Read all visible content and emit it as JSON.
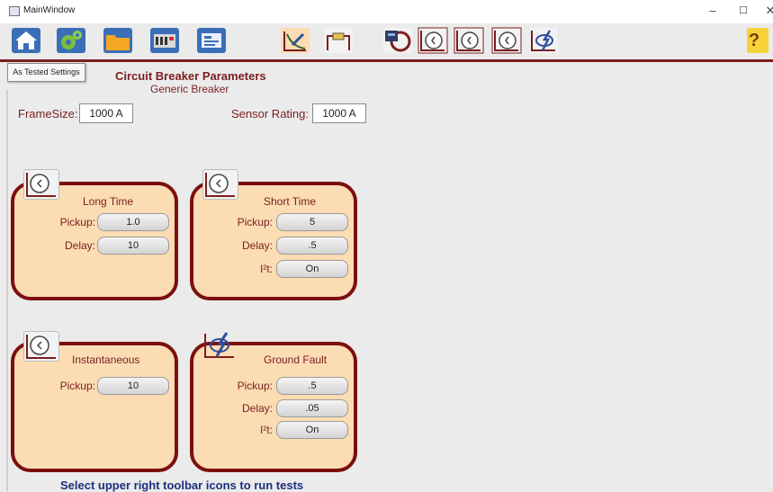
{
  "window": {
    "title": "MainWindow",
    "minimize": "–",
    "maximize": "☐",
    "close": "✕"
  },
  "toolbar": {
    "items": [
      "home-icon",
      "settings-gear-icon",
      "folder-icon",
      "test-set-icon",
      "breaker-settings-icon",
      "curve-edit-icon",
      "cable-connect-icon",
      "cb-test-icon",
      "long-time-test-icon",
      "short-time-test-icon",
      "instantaneous-test-icon",
      "ground-fault-test-icon",
      "help-icon"
    ],
    "help_label": "?"
  },
  "tooltip": "As Tested Settings",
  "header": {
    "title": "Circuit Breaker Parameters",
    "subtitle": "Generic Breaker"
  },
  "frame": {
    "label": "FrameSize:",
    "value": "1000 A"
  },
  "sensor": {
    "label": "Sensor Rating:",
    "value": "1000 A"
  },
  "long_time": {
    "title": "Long Time",
    "pickup_label": "Pickup:",
    "pickup": "1.0",
    "delay_label": "Delay:",
    "delay": "10"
  },
  "short_time": {
    "title": "Short Time",
    "pickup_label": "Pickup:",
    "pickup": "5",
    "delay_label": "Delay:",
    "delay": ".5",
    "i2t_label": "I²t:",
    "i2t": "On"
  },
  "instantaneous": {
    "title": "Instantaneous",
    "pickup_label": "Pickup:",
    "pickup": "10"
  },
  "ground_fault": {
    "title": "Ground Fault",
    "pickup_label": "Pickup:",
    "pickup": ".5",
    "delay_label": "Delay:",
    "delay": ".05",
    "i2t_label": "I²t:",
    "i2t": "On"
  },
  "footer": "Select upper right toolbar icons to run tests",
  "colors": {
    "accent": "#7b1e1e",
    "panel_fill": "#fbdcb3",
    "footer_text": "#1c2f80"
  }
}
